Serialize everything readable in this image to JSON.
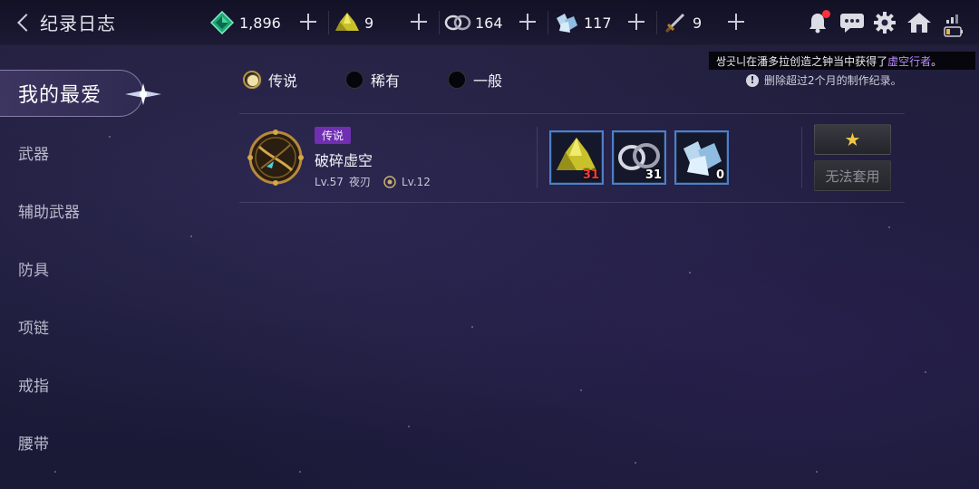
{
  "header": {
    "title": "纪录日志"
  },
  "currencies": [
    {
      "name": "emerald-gem",
      "value": "1,896"
    },
    {
      "name": "yellow-ore",
      "value": "9"
    },
    {
      "name": "silver-ring",
      "value": "164"
    },
    {
      "name": "ice-crystal",
      "value": "117"
    },
    {
      "name": "dagger",
      "value": "9"
    }
  ],
  "system_icons": [
    "bell-icon",
    "chat-icon",
    "gear-icon",
    "home-icon",
    "signal-icon",
    "battery-icon"
  ],
  "notification": {
    "prefix": "쌍곳니在潘多拉创造之钟当中获得了",
    "highlight": "虚空行者",
    "suffix": "。",
    "highlight_color": "#b98cff"
  },
  "delete_info": "删除超过2个月的制作纪录。",
  "sidebar": {
    "active": "我的最爱",
    "items": [
      "武器",
      "辅助武器",
      "防具",
      "项链",
      "戒指",
      "腰带"
    ]
  },
  "filters": [
    {
      "label": "传说",
      "selected": true
    },
    {
      "label": "稀有",
      "selected": false
    },
    {
      "label": "一般",
      "selected": false
    }
  ],
  "item": {
    "grade_tag": "传说",
    "name": "破碎虚空",
    "level": "Lv.57",
    "class": "夜刃",
    "craft_level": "Lv.12",
    "materials": [
      {
        "name": "yellow-ore",
        "count": "31",
        "insufficient": true
      },
      {
        "name": "silver-ring",
        "count": "31",
        "insufficient": false
      },
      {
        "name": "ice-crystal",
        "count": "0",
        "insufficient": false
      }
    ],
    "favorite_symbol": "★",
    "apply_label": "无法套用"
  },
  "colors": {
    "legend_tag": "#6f2fb0",
    "star": "#f3c742",
    "material_border": "#4f7fc8",
    "insufficient": "#ff3b3b"
  }
}
